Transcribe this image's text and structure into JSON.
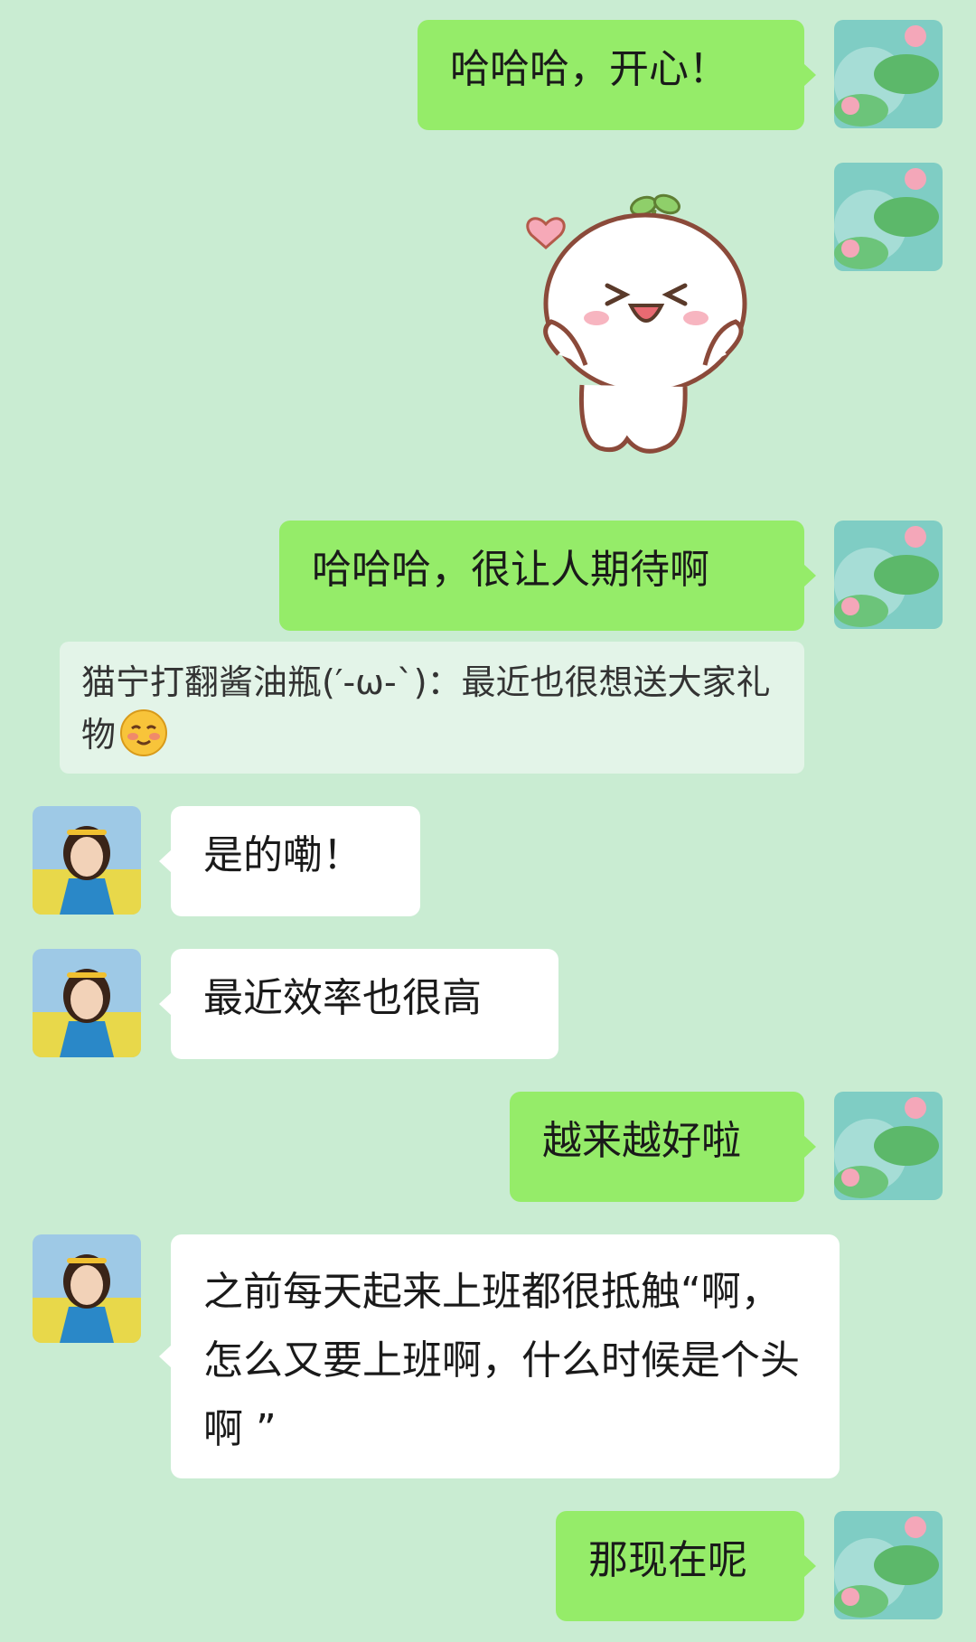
{
  "messages": {
    "m1": "哈哈哈，开心！",
    "m3": "哈哈哈，很让人期待啊",
    "quote": "猫宁打翻酱油瓶(′-ω-`)：最近也很想送大家礼物",
    "m4": "是的嘞！",
    "m5": "最近效率也很高",
    "m6": "越来越好啦",
    "m7": "之前每天起来上班都很抵触“啊，怎么又要上班啊，什么时候是个头啊 ”",
    "m8": "那现在呢"
  },
  "colors": {
    "background": "#c9ecd2",
    "my_bubble": "#95ec69",
    "other_bubble": "#ffffff",
    "quote_block": "#e3f4e8"
  },
  "icons": {
    "my_avatar": "lotus-pond-avatar-icon",
    "other_avatar": "girl-photo-avatar-icon",
    "sticker": "sprout-blob-sticker-icon",
    "emoji": "shy-smile-emoji-icon"
  }
}
